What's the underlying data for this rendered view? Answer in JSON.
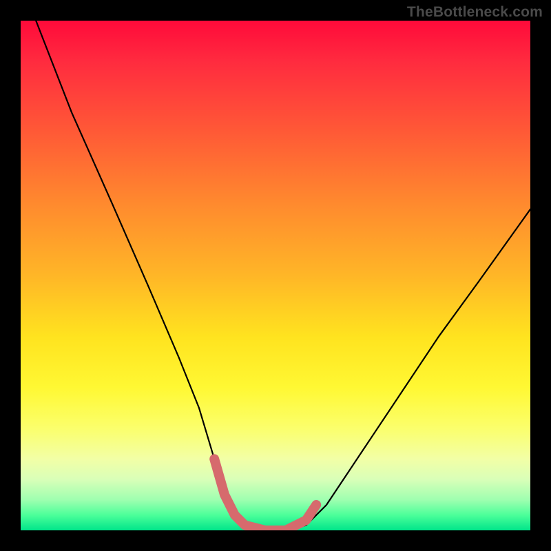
{
  "watermark": {
    "text": "TheBottleneck.com"
  },
  "chart_data": {
    "type": "line",
    "title": "",
    "xlabel": "",
    "ylabel": "",
    "xlim": [
      0,
      100
    ],
    "ylim": [
      0,
      100
    ],
    "series": [
      {
        "name": "bottleneck-curve",
        "x": [
          3,
          10,
          18,
          25,
          31,
          35,
          38,
          40,
          42,
          44,
          48,
          52,
          56,
          60,
          66,
          74,
          82,
          90,
          100
        ],
        "y": [
          100,
          82,
          64,
          48,
          34,
          24,
          14,
          7,
          3,
          1,
          0,
          0,
          1,
          5,
          14,
          26,
          38,
          49,
          63
        ]
      }
    ],
    "highlight_segment": {
      "name": "bottom-highlight",
      "x": [
        38,
        40,
        42,
        44,
        48,
        52,
        56,
        58
      ],
      "y": [
        14,
        7,
        3,
        1,
        0,
        0,
        2,
        5
      ]
    },
    "background": {
      "type": "vertical-gradient",
      "stops": [
        {
          "pos": 0.0,
          "color": "#ff0a3a"
        },
        {
          "pos": 0.5,
          "color": "#ffb627"
        },
        {
          "pos": 0.72,
          "color": "#fff833"
        },
        {
          "pos": 1.0,
          "color": "#00e58a"
        }
      ]
    }
  }
}
